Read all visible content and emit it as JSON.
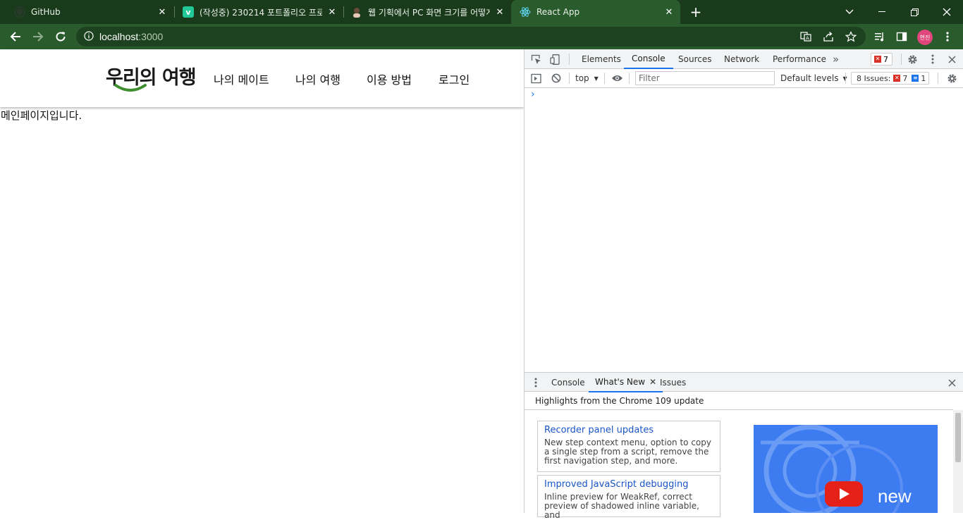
{
  "browser": {
    "tabs": [
      {
        "title": "GitHub",
        "icon": "github-icon"
      },
      {
        "title": "(작성중) 230214 포트폴리오 프로",
        "icon": "velog-icon",
        "fav_text": "v"
      },
      {
        "title": "웹 기획에서 PC 화면 크기를 어떻게",
        "icon": "blog-icon"
      },
      {
        "title": "React App",
        "icon": "react-icon"
      }
    ],
    "new_tab_label": "+",
    "url_host": "localhost",
    "url_port": ":3000",
    "profile_label": "현진"
  },
  "site": {
    "logo_text": "우리의 여행",
    "nav": [
      "나의 메이트",
      "나의 여행",
      "이용 방법",
      "로그인"
    ],
    "main_text": "메인페이지입니다."
  },
  "devtools": {
    "tabs": [
      "Elements",
      "Console",
      "Sources",
      "Network",
      "Performance"
    ],
    "active_tab": "Console",
    "overflow_label": "»",
    "error_count": "7",
    "context": "top",
    "filter_placeholder": "Filter",
    "levels": "Default levels",
    "issues_label": "8 Issues:",
    "issues_errors": "7",
    "issues_info": "1",
    "prompt": "›",
    "drawer_tabs": [
      "Console",
      "What's New",
      "Issues"
    ],
    "drawer_active": "What's New",
    "whats_new_header": "Highlights from the Chrome 109 update",
    "cards": [
      {
        "title": "Recorder panel updates",
        "desc": "New step context menu, option to copy a single step from a script, remove the first navigation step, and more."
      },
      {
        "title": "Improved JavaScript debugging",
        "desc": "Inline preview for WeakRef, correct preview of shadowed inline variable, and"
      }
    ],
    "video_text": "new"
  },
  "colors": {
    "tabstrip": "#1a3a1c",
    "toolbar": "#2a5b2d",
    "accent": "#1a73e8",
    "logo_green": "#3f8f2f",
    "profile": "#e0457b"
  }
}
